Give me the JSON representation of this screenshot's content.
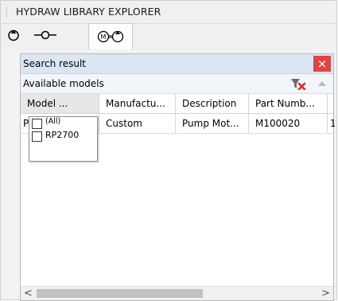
{
  "window": {
    "title": "HYDRAW LIBRARY EXPLORER"
  },
  "tabs": [
    {
      "icon": "pump-symbol-icon",
      "active": false
    },
    {
      "icon": "line-connector-icon",
      "active": false
    },
    {
      "icon": "pump-motor-icon",
      "active": true
    }
  ],
  "search": {
    "header_label": "Search result",
    "close_label": "×",
    "subheader_label": "Available models"
  },
  "grid": {
    "columns": [
      "Model ...",
      "Manufactu...",
      "Description",
      "Part Numb..."
    ],
    "rows": [
      {
        "model": "P",
        "manufacturer": "Custom",
        "description": "Pump Mot...",
        "part_number": "M100020",
        "overflow": "1"
      }
    ]
  },
  "filter_popup": {
    "options": [
      {
        "label": "(All)",
        "checked": false
      },
      {
        "label": "RP2700",
        "checked": false
      }
    ]
  },
  "scrollbar": {
    "left_arrow": "<",
    "right_arrow": ">"
  },
  "colors": {
    "close_red": "#e04343",
    "header_blue": "#dbe6f4",
    "filter_clear_red": "#e02a2a",
    "filter_clear_grey": "#6e6e6e"
  }
}
